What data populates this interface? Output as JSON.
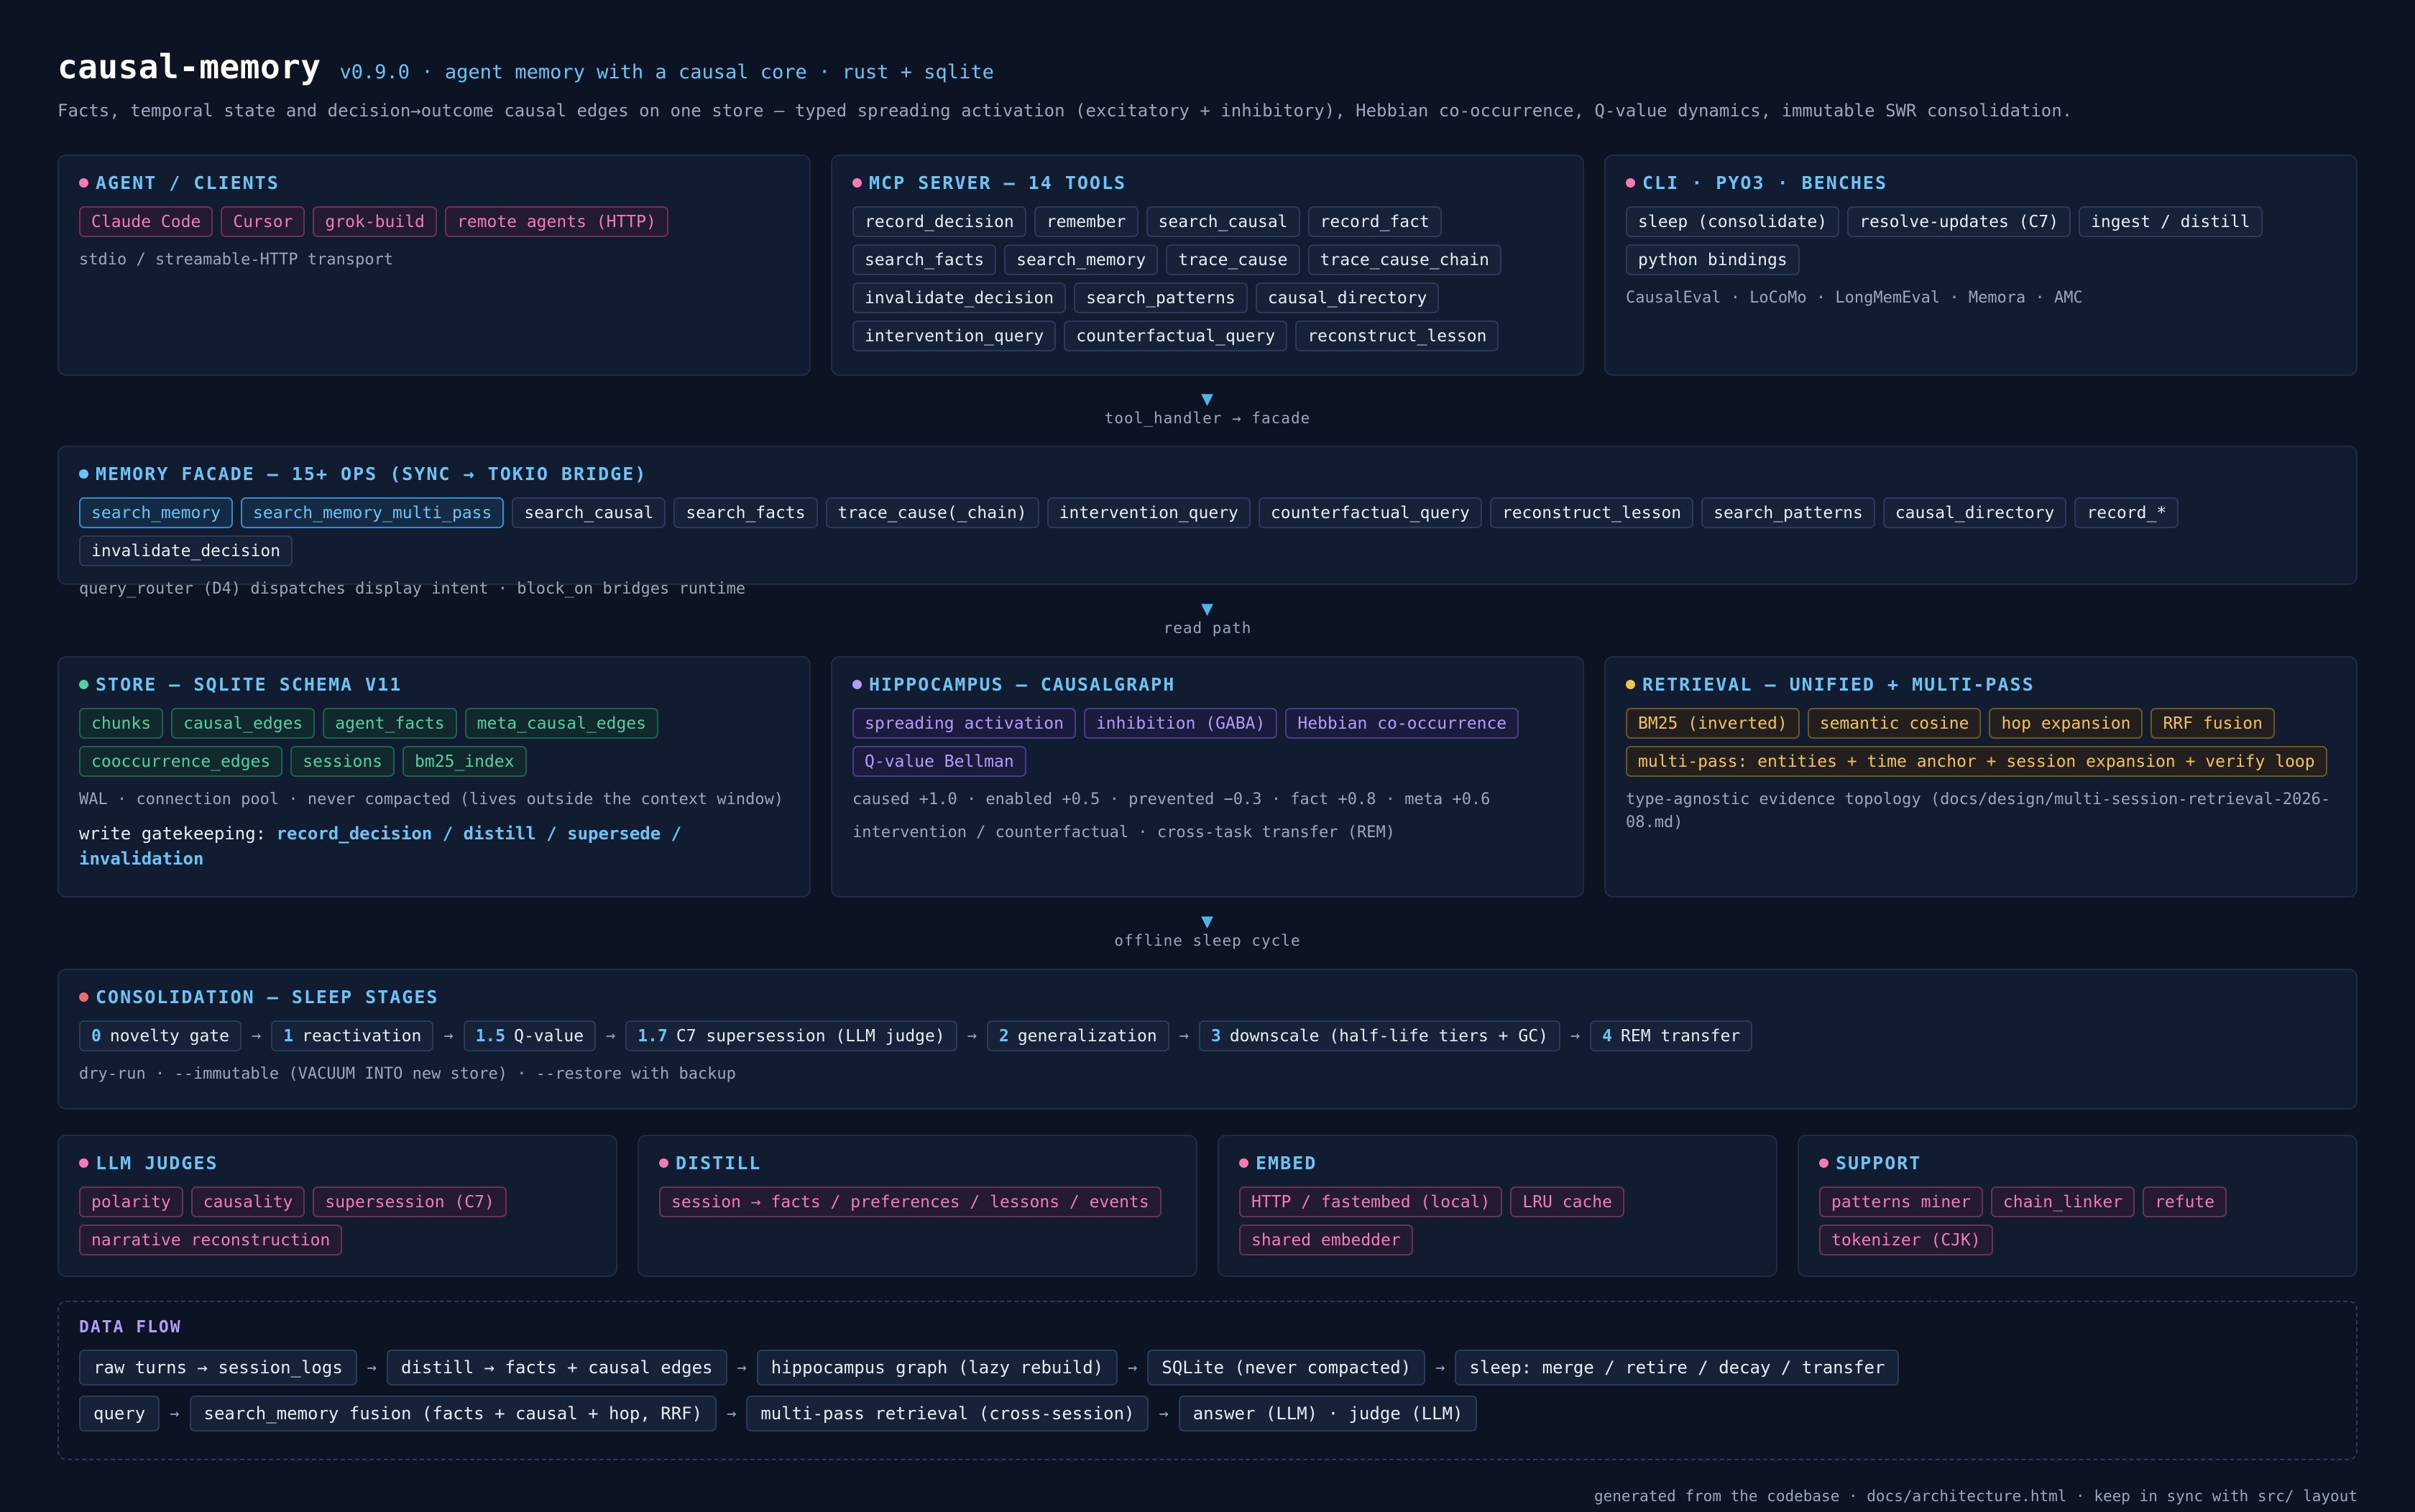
{
  "header": {
    "title": "causal-memory",
    "version": "v0.9.0 · agent memory with a causal core · rust + sqlite",
    "subtitle": "Facts, temporal state and decision→outcome causal edges on one store — typed spreading activation (excitatory + inhibitory), Hebbian co-occurrence, Q-value dynamics, immutable SWR consolidation."
  },
  "colors": {
    "background": "#0c1424",
    "panel": "#111c31",
    "accent_blue": "#6cc4f4",
    "pink": "#f47bb4",
    "green": "#4fd1a1",
    "purple": "#b29cf8",
    "yellow": "#f3c44d",
    "red": "#f26b6b"
  },
  "clients": {
    "title": "AGENT / CLIENTS",
    "chips": [
      "Claude Code",
      "Cursor",
      "grok-build",
      "remote agents (HTTP)"
    ],
    "note": "stdio / streamable-HTTP transport"
  },
  "mcp": {
    "title": "MCP SERVER — 14 TOOLS",
    "chips": [
      "record_decision",
      "remember",
      "search_causal",
      "record_fact",
      "search_facts",
      "search_memory",
      "trace_cause",
      "trace_cause_chain",
      "invalidate_decision",
      "search_patterns",
      "causal_directory",
      "intervention_query",
      "counterfactual_query",
      "reconstruct_lesson"
    ]
  },
  "cli": {
    "title": "CLI · PYO3 · BENCHES",
    "chips": [
      "sleep (consolidate)",
      "resolve-updates (C7)",
      "ingest / distill",
      "python bindings"
    ],
    "note": "CausalEval · LoCoMo · LongMemEval · Memora · AMC"
  },
  "connectors": {
    "c1": "tool_handler → facade",
    "c2": "read path",
    "c3": "offline sleep cycle"
  },
  "facade": {
    "title": "MEMORY FACADE — 15+ OPS (SYNC → TOKIO BRIDGE)",
    "chips": [
      "search_memory",
      "search_memory_multi_pass",
      "search_causal",
      "search_facts",
      "trace_cause(_chain)",
      "intervention_query",
      "counterfactual_query",
      "reconstruct_lesson",
      "search_patterns",
      "causal_directory",
      "record_*",
      "invalidate_decision"
    ],
    "note": "query_router (D4) dispatches display intent · block_on bridges runtime"
  },
  "store": {
    "title": "STORE — SQLITE SCHEMA V11",
    "chips": [
      "chunks",
      "causal_edges",
      "agent_facts",
      "meta_causal_edges",
      "cooccurrence_edges",
      "sessions",
      "bm25_index"
    ],
    "note": "WAL · connection pool · never compacted (lives outside the context window)",
    "gate_label": "write gatekeeping: ",
    "gate_value": "record_decision / distill / supersede / invalidation"
  },
  "hippocampus": {
    "title": "HIPPOCAMPUS — CAUSALGRAPH",
    "chips": [
      "spreading activation",
      "inhibition (GABA)",
      "Hebbian co-occurrence",
      "Q-value Bellman"
    ],
    "note1": "caused +1.0 · enabled +0.5 · prevented −0.3 · fact +0.8 · meta +0.6",
    "note2": "intervention / counterfactual · cross-task transfer (REM)"
  },
  "retrieval": {
    "title": "RETRIEVAL — UNIFIED + MULTI-PASS",
    "chips": [
      "BM25 (inverted)",
      "semantic cosine",
      "hop expansion",
      "RRF fusion",
      "multi-pass: entities + time anchor + session expansion + verify loop"
    ],
    "note": "type-agnostic evidence topology (docs/design/multi-session-retrieval-2026-08.md)"
  },
  "consolidation": {
    "title": "CONSOLIDATION — SLEEP STAGES",
    "stages": [
      {
        "num": "0",
        "label": "novelty gate"
      },
      {
        "num": "1",
        "label": "reactivation"
      },
      {
        "num": "1.5",
        "label": "Q-value"
      },
      {
        "num": "1.7",
        "label": "C7 supersession (LLM judge)"
      },
      {
        "num": "2",
        "label": "generalization"
      },
      {
        "num": "3",
        "label": "downscale (half-life tiers + GC)"
      },
      {
        "num": "4",
        "label": "REM transfer"
      }
    ],
    "arrow": "→",
    "note": "dry-run · --immutable (VACUUM INTO new store) · --restore with backup"
  },
  "judges": {
    "title": "LLM JUDGES",
    "chips": [
      "polarity",
      "causality",
      "supersession (C7)",
      "narrative reconstruction"
    ]
  },
  "distill": {
    "title": "DISTILL",
    "chips": [
      "session → facts / preferences / lessons / events"
    ]
  },
  "embed": {
    "title": "EMBED",
    "chips": [
      "HTTP / fastembed (local)",
      "LRU cache",
      "shared embedder"
    ]
  },
  "support": {
    "title": "SUPPORT",
    "chips": [
      "patterns miner",
      "chain_linker",
      "refute",
      "tokenizer (CJK)"
    ]
  },
  "dataflow": {
    "title": "DATA FLOW",
    "row1": [
      "raw turns → session_logs",
      "distill → facts + causal edges",
      "hippocampus graph (lazy rebuild)",
      "SQLite (never compacted)",
      "sleep: merge / retire / decay / transfer"
    ],
    "row2": [
      "query",
      "search_memory fusion (facts + causal + hop, RRF)",
      "multi-pass retrieval (cross-session)",
      "answer (LLM) · judge (LLM)"
    ],
    "arrow": "→"
  },
  "footer": "generated from the codebase · docs/architecture.html · keep in sync with src/ layout"
}
